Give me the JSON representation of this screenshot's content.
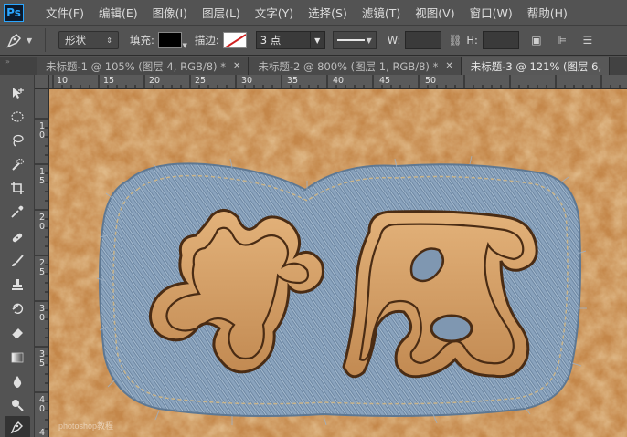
{
  "app": {
    "logo": "Ps"
  },
  "menu": [
    "文件(F)",
    "编辑(E)",
    "图像(I)",
    "图层(L)",
    "文字(Y)",
    "选择(S)",
    "滤镜(T)",
    "视图(V)",
    "窗口(W)",
    "帮助(H)"
  ],
  "options": {
    "mode": "形状",
    "fill_label": "填充:",
    "stroke_label": "描边:",
    "stroke_size": "3 点",
    "w_label": "W:",
    "h_label": "H:"
  },
  "tabs": [
    {
      "label": "未标题-1 @ 105% (图层 4, RGB/8) *",
      "active": false
    },
    {
      "label": "未标题-2 @ 800% (图层 1, RGB/8) *",
      "active": false
    },
    {
      "label": "未标题-3 @ 121% (图层 6,",
      "active": true
    }
  ],
  "ruler": {
    "top": [
      "10",
      "15",
      "20",
      "25",
      "30",
      "35",
      "40",
      "45",
      "50"
    ],
    "left": [
      "1 0",
      "1 5",
      "2 0",
      "2 5",
      "3 0",
      "3 5",
      "4 0",
      "4 5"
    ]
  },
  "colors": {
    "leather": "#c88a4a",
    "denim": "#7a93ad",
    "ui_bg": "#535353",
    "ps_blue": "#2aa6ff"
  },
  "icons": {
    "tools": [
      "move-icon",
      "marquee-ellipse-icon",
      "lasso-icon",
      "quick-select-icon",
      "crop-icon",
      "eyedropper-icon",
      "healing-brush-icon",
      "brush-icon",
      "clone-stamp-icon",
      "history-brush-icon",
      "eraser-icon",
      "gradient-icon",
      "blur-icon",
      "dodge-icon",
      "pen-icon"
    ]
  },
  "canvas": {
    "watermark": "photoshop教程"
  }
}
